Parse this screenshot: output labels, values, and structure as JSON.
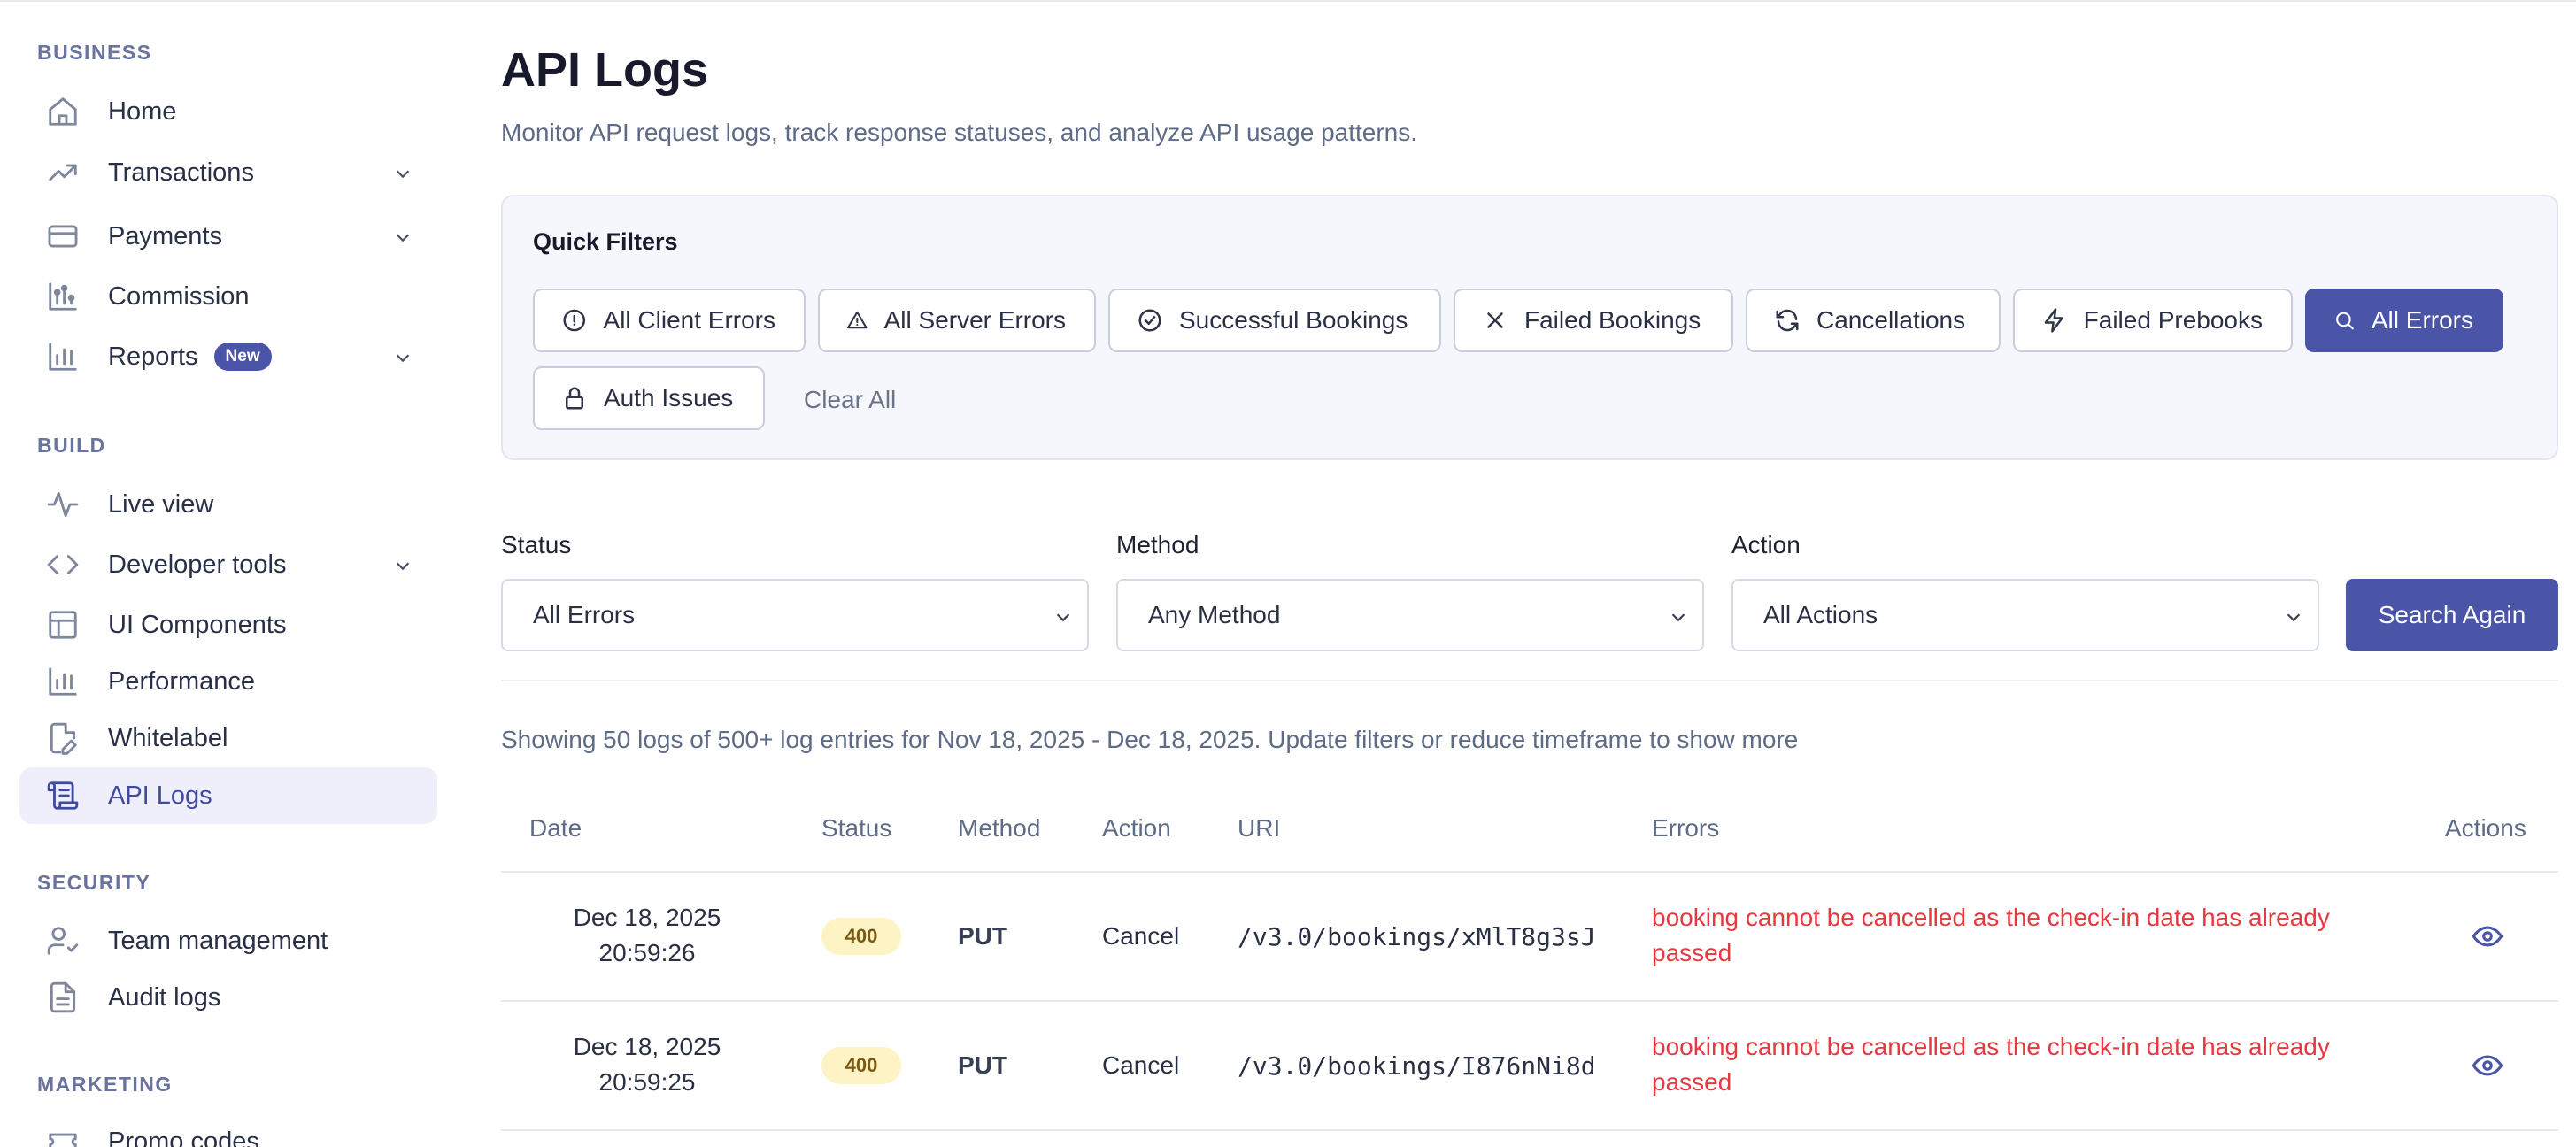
{
  "sidebar": {
    "business_heading": "BUSINESS",
    "build_heading": "BUILD",
    "security_heading": "SECURITY",
    "marketing_heading": "MARKETING",
    "items": [
      {
        "label": "Home",
        "icon": "home-icon"
      },
      {
        "label": "Transactions",
        "icon": "trending-up-icon"
      },
      {
        "label": "Payments",
        "icon": "credit-card-icon"
      },
      {
        "label": "Commission",
        "icon": "commission-icon"
      },
      {
        "label": "Reports",
        "icon": "bar-chart-icon",
        "badge": "New"
      },
      {
        "label": "Live view",
        "icon": "activity-icon"
      },
      {
        "label": "Developer tools",
        "icon": "code-icon"
      },
      {
        "label": "UI Components",
        "icon": "layout-icon"
      },
      {
        "label": "Performance",
        "icon": "bar-chart-icon"
      },
      {
        "label": "Whitelabel",
        "icon": "file-brush-icon"
      },
      {
        "label": "API Logs",
        "icon": "scroll-icon",
        "active": true
      },
      {
        "label": "Team management",
        "icon": "user-check-icon"
      },
      {
        "label": "Audit logs",
        "icon": "file-text-icon"
      },
      {
        "label": "Promo codes",
        "icon": "ticket-icon"
      }
    ]
  },
  "page": {
    "title": "API Logs",
    "subtitle": "Monitor API request logs, track response statuses, and analyze API usage patterns."
  },
  "quick_filters": {
    "title": "Quick Filters",
    "chips": [
      {
        "label": "All Client Errors",
        "icon": "alert-circle-icon"
      },
      {
        "label": "All Server Errors",
        "icon": "alert-triangle-icon"
      },
      {
        "label": "Successful Bookings",
        "icon": "check-circle-icon"
      },
      {
        "label": "Failed Bookings",
        "icon": "x-icon"
      },
      {
        "label": "Cancellations",
        "icon": "refresh-icon"
      },
      {
        "label": "Failed Prebooks",
        "icon": "zap-icon"
      },
      {
        "label": "All Errors",
        "icon": "search-icon",
        "active": true
      },
      {
        "label": "Auth Issues",
        "icon": "lock-icon"
      }
    ],
    "clear_all": "Clear All"
  },
  "filters": {
    "status_label": "Status",
    "status_value": "All Errors",
    "method_label": "Method",
    "method_value": "Any Method",
    "action_label": "Action",
    "action_value": "All Actions",
    "search_button": "Search Again"
  },
  "results": {
    "summary": "Showing 50 logs of 500+ log entries for Nov 18, 2025 - Dec 18, 2025. Update filters or reduce timeframe to show more"
  },
  "table": {
    "headers": {
      "date": "Date",
      "status": "Status",
      "method": "Method",
      "action": "Action",
      "uri": "URI",
      "errors": "Errors",
      "actions": "Actions"
    },
    "rows": [
      {
        "date": "Dec 18, 2025",
        "time": "20:59:26",
        "status": "400",
        "method": "PUT",
        "action": "Cancel",
        "uri": "/v3.0/bookings/xMlT8g3sJ",
        "error": "booking cannot be cancelled as the check-in date has already passed"
      },
      {
        "date": "Dec 18, 2025",
        "time": "20:59:25",
        "status": "400",
        "method": "PUT",
        "action": "Cancel",
        "uri": "/v3.0/bookings/I876nNi8d",
        "error": "booking cannot be cancelled as the check-in date has already passed"
      }
    ]
  },
  "colors": {
    "accent": "#4a55a8",
    "error_text": "#e5393f",
    "badge_bg": "#fdf3c4",
    "active_nav_bg": "#efeefb"
  }
}
